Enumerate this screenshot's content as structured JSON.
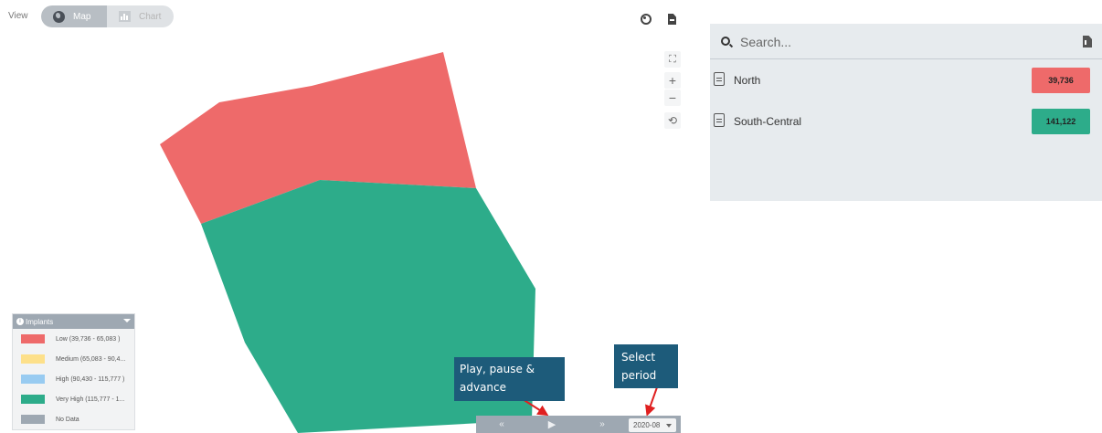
{
  "view": {
    "label": "View",
    "map_label": "Map",
    "chart_label": "Chart",
    "selected": "Map"
  },
  "map": {
    "regions": [
      {
        "name": "North",
        "color": "#ee6a6a"
      },
      {
        "name": "South-Central",
        "color": "#2dac8a"
      }
    ],
    "controls": {
      "zoom_in": "+",
      "zoom_out": "−"
    }
  },
  "legend": {
    "title": "Implants",
    "items": [
      {
        "label": "Low (39,736 - 65,083 )",
        "color": "#ee6a6a"
      },
      {
        "label": "Medium (65,083 - 90,4...",
        "color": "#fde08a"
      },
      {
        "label": "High (90,430 - 115,777 )",
        "color": "#98cbf1"
      },
      {
        "label": "Very High (115,777 - 1...",
        "color": "#2dac8a"
      },
      {
        "label": "No Data",
        "color": "#9ea8b2"
      }
    ]
  },
  "annotations": {
    "play": [
      "Play, pause &",
      "advance"
    ],
    "period": [
      "Select",
      "period"
    ]
  },
  "playback": {
    "prev": "«",
    "play": "▶",
    "next": "»",
    "period": "2020-08"
  },
  "panel": {
    "search_placeholder": "Search...",
    "items": [
      {
        "label": "North",
        "value": "39,736",
        "color": "#ee6a6a"
      },
      {
        "label": "South-Central",
        "value": "141,122",
        "color": "#2dac8a"
      }
    ]
  },
  "icons": [
    "globe-icon",
    "bar-chart-icon",
    "palette-icon",
    "export-icon",
    "fullscreen-icon",
    "reset-icon",
    "search-icon",
    "file-icon",
    "info-icon",
    "chevron-down-icon"
  ]
}
